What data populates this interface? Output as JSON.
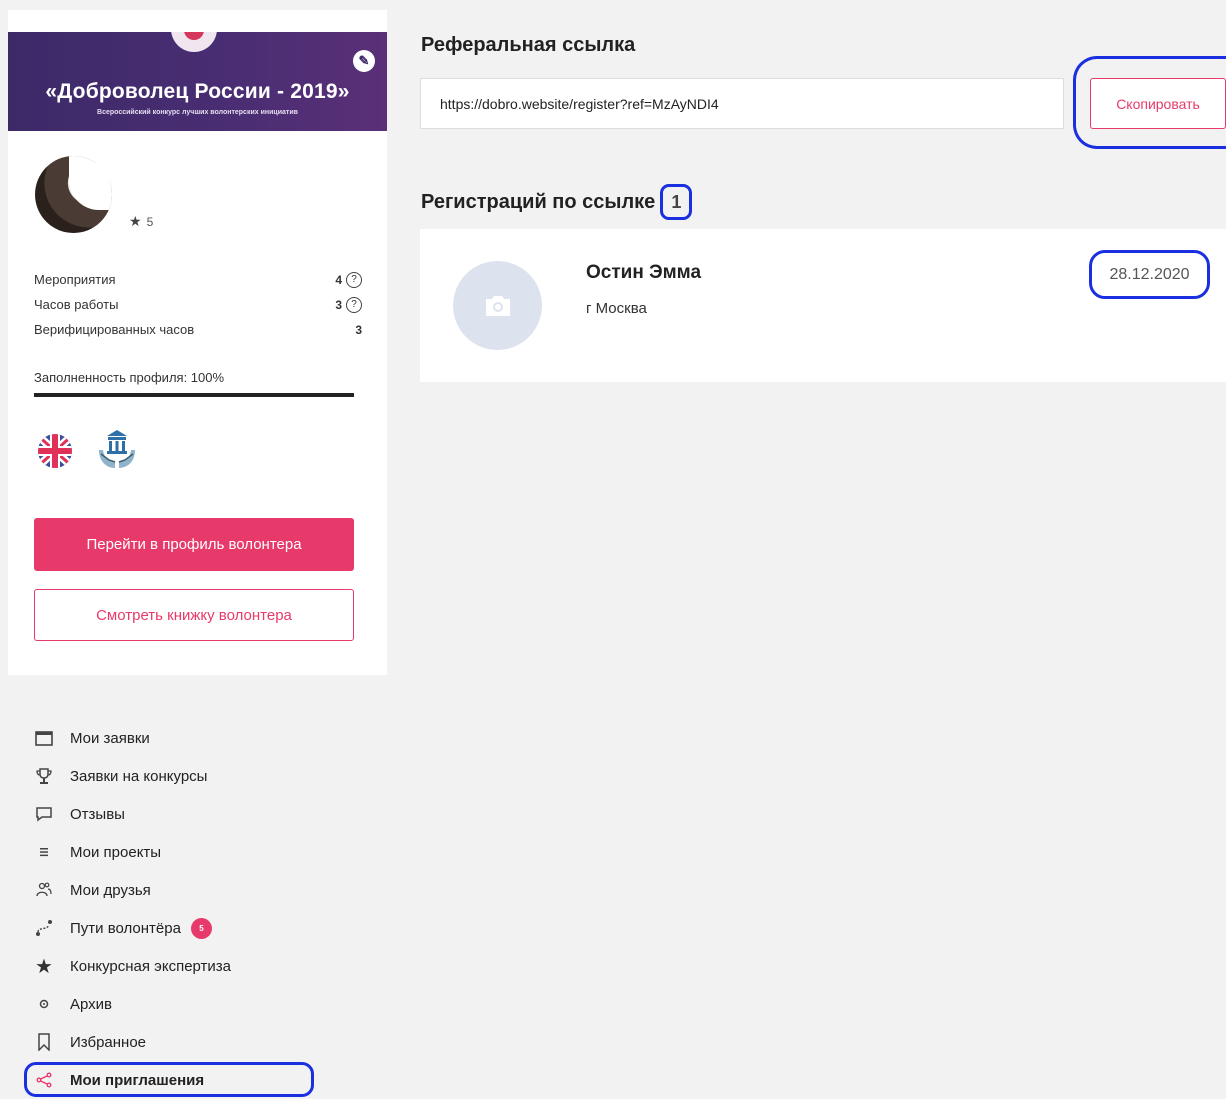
{
  "profile": {
    "banner_title": "«Доброволец России - 2019»",
    "banner_subtitle": "Всероссийский конкурс лучших волонтерских инициатив",
    "rating": "5",
    "stats": [
      {
        "label": "Мероприятия",
        "value": "4",
        "has_help": true
      },
      {
        "label": "Часов работы",
        "value": "3",
        "has_help": true
      },
      {
        "label": "Верифицированных часов",
        "value": "3",
        "has_help": false
      }
    ],
    "completeness_label": "Заполненность профиля: 100%",
    "completeness_value": 100,
    "primary_button": "Перейти в профиль волонтера",
    "secondary_button": "Смотреть книжку волонтера",
    "help_glyph": "?"
  },
  "menu": {
    "items": [
      {
        "label": "Мои заявки",
        "icon": "calendar-icon"
      },
      {
        "label": "Заявки на конкурсы",
        "icon": "trophy-icon"
      },
      {
        "label": "Отзывы",
        "icon": "comment-icon"
      },
      {
        "label": "Мои проекты",
        "icon": "list-icon"
      },
      {
        "label": "Мои друзья",
        "icon": "friends-icon"
      },
      {
        "label": "Пути волонтёра",
        "icon": "route-icon",
        "counter": "5"
      },
      {
        "label": "Конкурсная экспертиза",
        "icon": "star-icon"
      },
      {
        "label": "Архив",
        "icon": "archive-icon"
      },
      {
        "label": "Избранное",
        "icon": "bookmark-icon"
      },
      {
        "label": "Мои приглашения",
        "icon": "share-icon",
        "active": true
      }
    ]
  },
  "referral": {
    "title": "Реферальная ссылка",
    "link": "https://dobro.website/register?ref=MzAyNDI4",
    "copy_label": "Скопировать"
  },
  "registrations": {
    "title": "Регистраций по ссылке",
    "count": "1",
    "items": [
      {
        "name": "Остин Эмма",
        "city": "г Москва",
        "date": "28.12.2020"
      }
    ]
  },
  "colors": {
    "accent": "#e83a6a",
    "highlight": "#1a2fe0",
    "banner": "#3c2a68"
  }
}
